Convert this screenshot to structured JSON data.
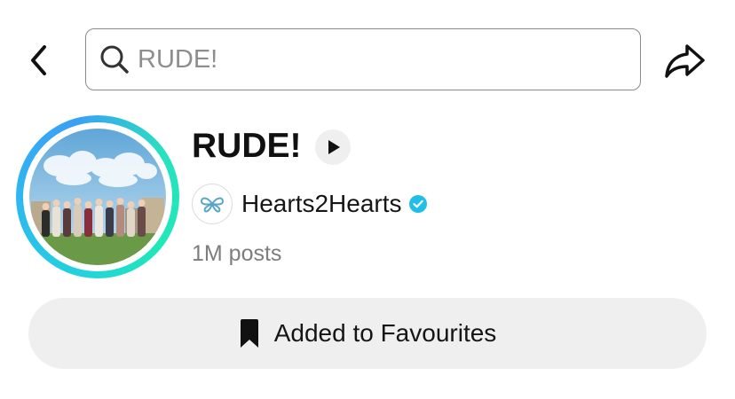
{
  "search": {
    "query": "RUDE!",
    "placeholder": "RUDE!"
  },
  "header": {
    "back_icon": "chevron-left-icon",
    "search_icon": "search-icon",
    "share_icon": "share-arrow-icon"
  },
  "sound": {
    "title": "RUDE!",
    "artist": "Hearts2Hearts",
    "artist_verified": true,
    "posts": "1M posts",
    "cover": "group-photo-cover"
  },
  "favourites": {
    "label": "Added to Favourites",
    "icon": "bookmark-filled-icon"
  },
  "colors": {
    "ring_start": "#22d0e0",
    "ring_end": "#28e1c0",
    "verified": "#20bfe8",
    "button_bg": "#efefef",
    "muted_text": "#7d7d7d"
  }
}
